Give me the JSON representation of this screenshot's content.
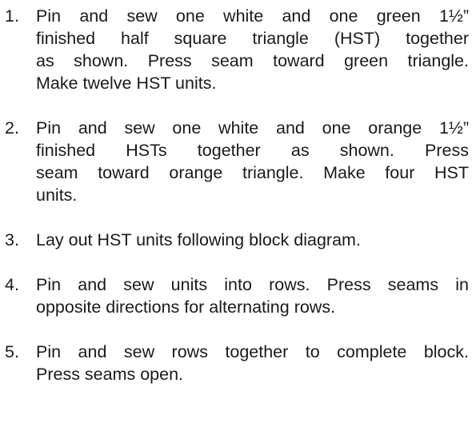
{
  "instructions": {
    "steps": [
      {
        "number": "1.",
        "lines": [
          "Pin and sew one white and one green 1½”",
          "finished half square triangle (HST) together",
          "as shown. Press seam toward green triangle.",
          "Make twelve HST units."
        ]
      },
      {
        "number": "2.",
        "lines": [
          "Pin and sew one white and one orange 1½”",
          "finished HSTs together as shown. Press",
          "seam toward orange triangle. Make four HST",
          "units."
        ]
      },
      {
        "number": "3.",
        "lines": [
          "Lay out HST units following block diagram."
        ]
      },
      {
        "number": "4.",
        "lines": [
          "Pin and sew units into rows. Press seams in",
          "opposite directions for alternating rows."
        ]
      },
      {
        "number": "5.",
        "lines": [
          "Pin and sew rows together to complete block.",
          "Press seams open."
        ]
      }
    ]
  }
}
